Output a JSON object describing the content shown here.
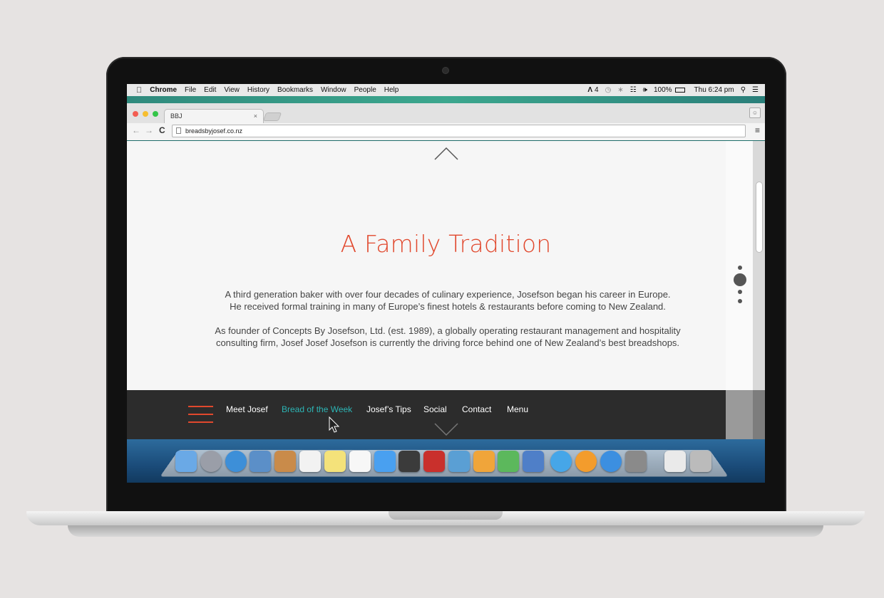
{
  "menubar": {
    "apple": "",
    "app": "Chrome",
    "items": [
      "File",
      "Edit",
      "View",
      "History",
      "Bookmarks",
      "Window",
      "People",
      "Help"
    ],
    "status": {
      "adobe": "4",
      "battery": "100%",
      "clock": "Thu 6:24 pm"
    }
  },
  "browser": {
    "tab_title": "BBJ",
    "tab_close": "×",
    "url": "breadsbyjosef.co.nz",
    "back": "←",
    "forward": "→",
    "reload": "C",
    "menu": "≡"
  },
  "page": {
    "title": "A Family Tradition",
    "paragraph1_line1": "A third generation baker with over four decades of culinary experience, Josefson began his career in Europe.",
    "paragraph1_line2": "He received formal training in many of Europe’s finest hotels & restaurants before coming to New Zealand.",
    "paragraph2_line1": "As founder of Concepts By Josefson, Ltd. (est. 1989), a globally operating restaurant management and hospitality",
    "paragraph2_line2": "consulting firm, Josef Josef Josefson is currently the driving force behind one of New Zealand’s best breadshops.",
    "section_dots": {
      "count": 4,
      "active_index": 1
    }
  },
  "footer_nav": {
    "items": [
      {
        "label": "Meet Josef",
        "active": false
      },
      {
        "label": "Bread of the Week",
        "active": true
      },
      {
        "label": "Josef’s Tips",
        "active": false
      },
      {
        "label": "Social",
        "active": false
      },
      {
        "label": "Contact",
        "active": false
      },
      {
        "label": "Menu",
        "active": false
      }
    ]
  },
  "colors": {
    "accent_red": "#e1482d",
    "accent_teal": "#2cb5b5",
    "footer_bg": "#2c2c2c"
  },
  "dock": {
    "icons": [
      "finder-icon",
      "launchpad-icon",
      "safari-icon",
      "mail-icon",
      "contacts-icon",
      "calendar-icon",
      "notes-icon",
      "reminders-icon",
      "messages-icon",
      "facetime-icon",
      "photo-booth-icon",
      "iphoto-icon",
      "pages-icon",
      "numbers-icon",
      "keynote-icon",
      "itunes-icon",
      "ibooks-icon",
      "app-store-icon",
      "system-preferences-icon",
      "document-icon",
      "trash-icon"
    ]
  }
}
